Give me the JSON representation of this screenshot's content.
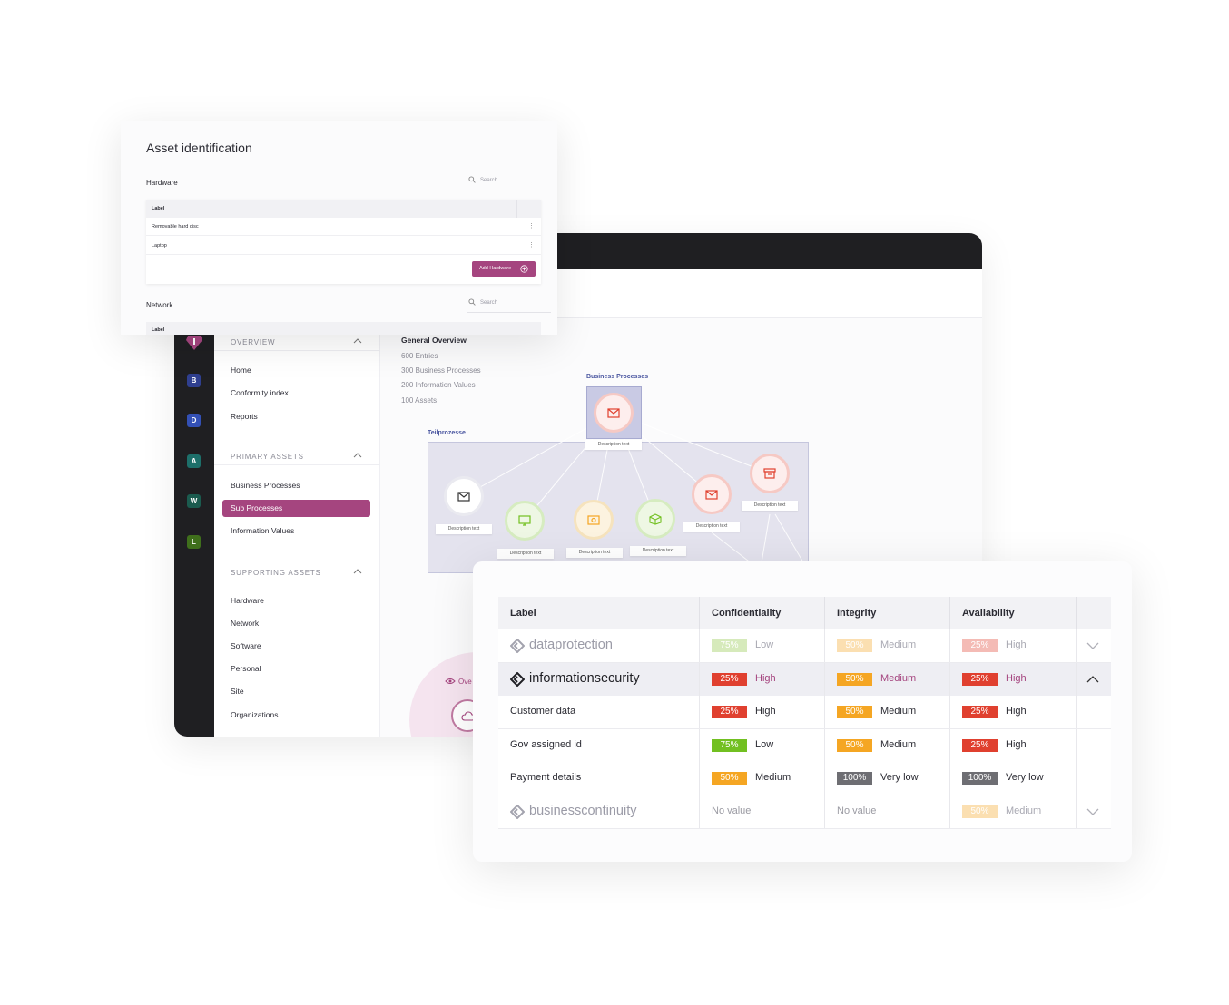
{
  "asset_card": {
    "title": "Asset identification",
    "hardware_section": "Hardware",
    "network_section": "Network",
    "search_placeholder": "Search",
    "table_header_label": "Label",
    "hardware_rows": [
      "Removable hard disc",
      "Laptop"
    ],
    "add_hardware_button": "Add Hardware"
  },
  "rail": {
    "buttons": [
      {
        "letter": "B",
        "color": "#2f3f8f"
      },
      {
        "letter": "D",
        "color": "#3350b5"
      },
      {
        "letter": "A",
        "color": "#1d6f6a"
      },
      {
        "letter": "W",
        "color": "#1b5b4f"
      },
      {
        "letter": "L",
        "color": "#3f6f1c"
      }
    ],
    "logo_color": "#a5457f"
  },
  "side_menu": {
    "sections": {
      "overview": "OVERVIEW",
      "primary": "PRIMARY ASSETS",
      "supporting": "SUPPORTING ASSETS"
    },
    "overview_items": [
      "Home",
      "Conformity index",
      "Reports"
    ],
    "primary_items": [
      "Business Processes",
      "Sub Processes",
      "Information Values"
    ],
    "active_item": "Sub Processes",
    "supporting_items": [
      "Hardware",
      "Network",
      "Software",
      "Personal",
      "Site",
      "Organizations"
    ]
  },
  "overview": {
    "title": "General Overview",
    "stats": [
      "600 Entries",
      "300 Business Processes",
      "200 Information Values",
      "100 Assets"
    ],
    "bubble_label": "Ove"
  },
  "diagram": {
    "business_processes_label": "Business Processes",
    "teilprozesse_label": "Teilprozesse",
    "node_label": "Description text"
  },
  "cia_table": {
    "headers": [
      "Label",
      "Confidentiality",
      "Integrity",
      "Availability"
    ],
    "groups": [
      {
        "name": "dataprotection",
        "state": "collapsed",
        "values": [
          {
            "pct": "75%",
            "level": "Low",
            "color": "#8cc63f"
          },
          {
            "pct": "50%",
            "level": "Medium",
            "color": "#f5a623"
          },
          {
            "pct": "25%",
            "level": "High",
            "color": "#e0402f"
          }
        ]
      },
      {
        "name": "informationsecurity",
        "state": "expanded",
        "values": [
          {
            "pct": "25%",
            "level": "High",
            "color": "#e0402f"
          },
          {
            "pct": "50%",
            "level": "Medium",
            "color": "#f5a623"
          },
          {
            "pct": "25%",
            "level": "High",
            "color": "#e0402f"
          }
        ],
        "rows": [
          {
            "label": "Customer data",
            "values": [
              {
                "pct": "25%",
                "level": "High",
                "color": "#e0402f"
              },
              {
                "pct": "50%",
                "level": "Medium",
                "color": "#f5a623"
              },
              {
                "pct": "25%",
                "level": "High",
                "color": "#e0402f"
              }
            ]
          },
          {
            "label": "Gov assigned id",
            "values": [
              {
                "pct": "75%",
                "level": "Low",
                "color": "#72c021"
              },
              {
                "pct": "50%",
                "level": "Medium",
                "color": "#f5a623"
              },
              {
                "pct": "25%",
                "level": "High",
                "color": "#e0402f"
              }
            ]
          },
          {
            "label": "Payment details",
            "values": [
              {
                "pct": "50%",
                "level": "Medium",
                "color": "#f5a623"
              },
              {
                "pct": "100%",
                "level": "Very low",
                "color": "#6e6e73"
              },
              {
                "pct": "100%",
                "level": "Very low",
                "color": "#6e6e73"
              }
            ]
          }
        ]
      },
      {
        "name": "businesscontinuity",
        "state": "collapsed",
        "values": [
          {
            "novalue": "No value"
          },
          {
            "novalue": "No value"
          },
          {
            "pct": "50%",
            "level": "Medium",
            "color": "#f5a623"
          }
        ]
      }
    ]
  },
  "colors": {
    "accent": "#a5457f",
    "level_text_expanded_group": "#a5457f"
  }
}
